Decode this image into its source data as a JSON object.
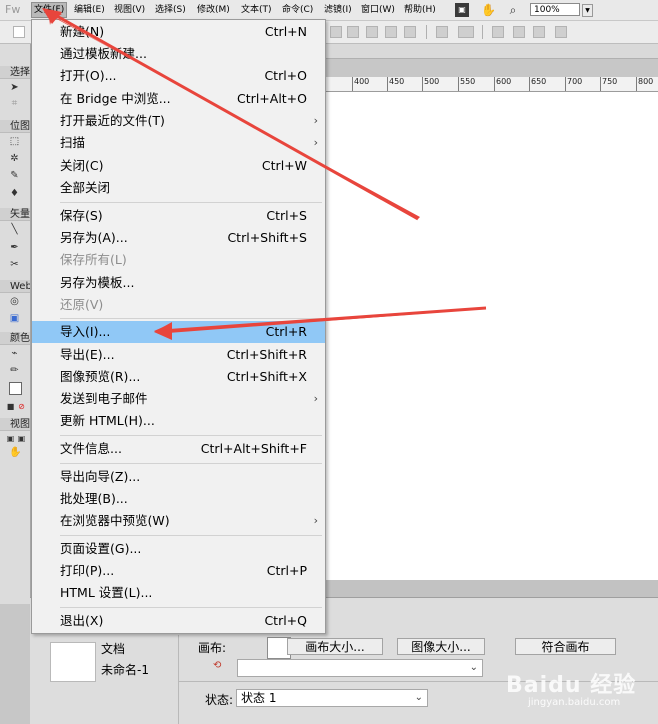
{
  "app": {
    "logo": "Fw"
  },
  "menubar": {
    "items": [
      {
        "label": "文件(F)",
        "active": true
      },
      {
        "label": "编辑(E)"
      },
      {
        "label": "视图(V)"
      },
      {
        "label": "选择(S)"
      },
      {
        "label": "修改(M)"
      },
      {
        "label": "文本(T)"
      },
      {
        "label": "命令(C)"
      },
      {
        "label": "滤镜(I)"
      },
      {
        "label": "窗口(W)"
      },
      {
        "label": "帮助(H)"
      }
    ],
    "zoom": "100%"
  },
  "tools_panel": {
    "sections": [
      "选择",
      "位图",
      "矢量",
      "Web",
      "颜色",
      "视图"
    ]
  },
  "ruler": {
    "ticks": [
      "400",
      "450",
      "500",
      "550",
      "600",
      "650",
      "700",
      "750",
      "800"
    ]
  },
  "file_menu": {
    "items": [
      {
        "label": "新建(N)",
        "shortcut": "Ctrl+N"
      },
      {
        "label": "通过模板新建..."
      },
      {
        "label": "打开(O)...",
        "shortcut": "Ctrl+O"
      },
      {
        "label": "在 Bridge 中浏览...",
        "shortcut": "Ctrl+Alt+O"
      },
      {
        "label": "打开最近的文件(T)",
        "submenu": true
      },
      {
        "label": "扫描",
        "submenu": true
      },
      {
        "label": "关闭(C)",
        "shortcut": "Ctrl+W"
      },
      {
        "label": "全部关闭"
      },
      {
        "label": "保存(S)",
        "shortcut": "Ctrl+S"
      },
      {
        "label": "另存为(A)...",
        "shortcut": "Ctrl+Shift+S"
      },
      {
        "label": "保存所有(L)",
        "disabled": true
      },
      {
        "label": "另存为模板..."
      },
      {
        "label": "还原(V)",
        "disabled": true
      },
      {
        "label": "导入(I)...",
        "shortcut": "Ctrl+R",
        "highlighted": true
      },
      {
        "label": "导出(E)...",
        "shortcut": "Ctrl+Shift+R"
      },
      {
        "label": "图像预览(R)...",
        "shortcut": "Ctrl+Shift+X"
      },
      {
        "label": "发送到电子邮件",
        "submenu": true
      },
      {
        "label": "更新 HTML(H)..."
      },
      {
        "label": "文件信息...",
        "shortcut": "Ctrl+Alt+Shift+F"
      },
      {
        "label": "导出向导(Z)..."
      },
      {
        "label": "批处理(B)..."
      },
      {
        "label": "在浏览器中预览(W)",
        "submenu": true
      },
      {
        "label": "页面设置(G)..."
      },
      {
        "label": "打印(P)...",
        "shortcut": "Ctrl+P"
      },
      {
        "label": "HTML 设置(L)..."
      },
      {
        "label": "退出(X)",
        "shortcut": "Ctrl+Q"
      }
    ]
  },
  "properties": {
    "doc_type": "文档",
    "doc_name": "未命名-1",
    "canvas_label": "画布:",
    "canvas_size_button": "画布大小...",
    "image_size_button": "图像大小...",
    "fit_canvas_button": "符合画布",
    "state_label": "状态:",
    "state_value": "状态 1"
  },
  "watermark": {
    "brand": "Baidu 经验",
    "url": "jingyan.baidu.com"
  },
  "colors": {
    "highlight": "#90c8f6",
    "arrow": "#e8453c"
  }
}
